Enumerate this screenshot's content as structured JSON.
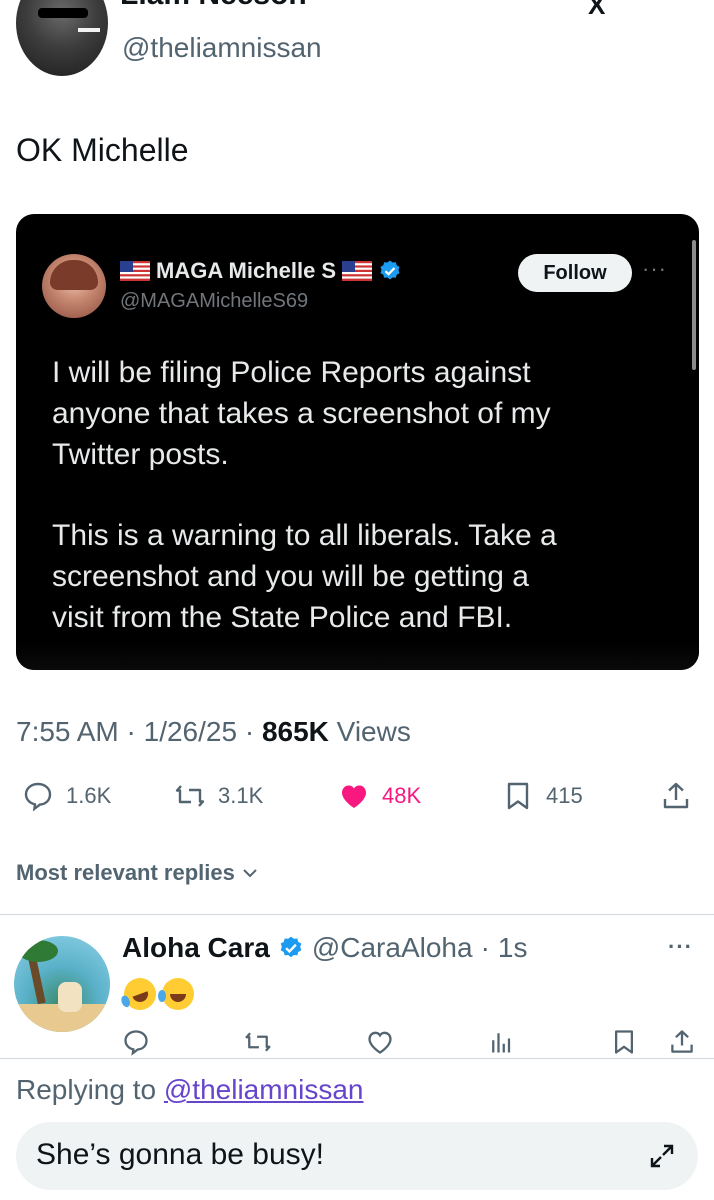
{
  "original_tweet": {
    "display_name_partial": "Liam Neeson",
    "handle": "@theliamnissan",
    "top_right_icon": "X",
    "text": "OK Michelle",
    "meta": {
      "time": "7:55 AM",
      "sep1": "·",
      "date": "1/26/25",
      "sep2": "·",
      "views_count": "865K",
      "views_label": "Views"
    },
    "stats": {
      "replies": "1.6K",
      "reposts": "3.1K",
      "likes": "48K",
      "bookmarks": "415"
    }
  },
  "embedded_post": {
    "display_name": "MAGA Michelle S",
    "handle": "@MAGAMichelleS69",
    "follow_label": "Follow",
    "more_label": "···",
    "paragraph_1": "I will be filing Police Reports against\nanyone that takes a screenshot of my\nTwitter posts.",
    "paragraph_2": "This is a warning to all liberals. Take a\nscreenshot and you will be getting a\nvisit from the State Police and FBI."
  },
  "replies_filter": {
    "label": "Most relevant replies"
  },
  "reply": {
    "display_name": "Aloha Cara",
    "handle": "@CaraAloha",
    "sep": "·",
    "age": "1s",
    "more_label": "···"
  },
  "composer": {
    "replying_prefix": "Replying to",
    "replying_to": "@theliamnissan",
    "draft_text": "She’s gonna be busy!"
  },
  "colors": {
    "like_pink": "#f91880",
    "verified_blue": "#1d9bf0",
    "muted": "#536471",
    "mention_link": "#6644cc"
  },
  "icons": [
    "reply-icon",
    "repost-icon",
    "like-icon",
    "bookmark-icon",
    "share-icon",
    "verified-icon",
    "us-flag-icon",
    "views-icon",
    "expand-icon",
    "chevron-down-icon",
    "more-icon"
  ]
}
